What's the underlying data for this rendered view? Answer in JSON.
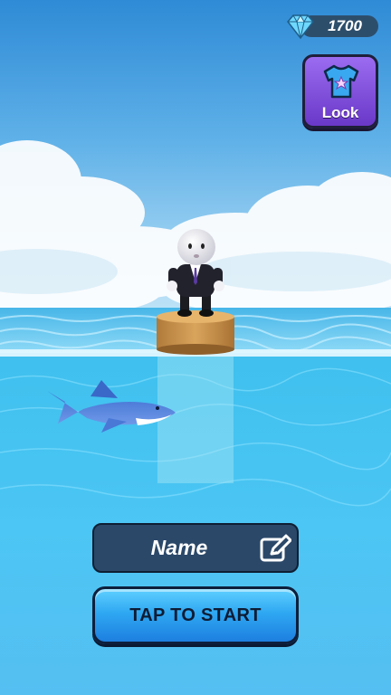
{
  "hud": {
    "gems": {
      "icon": "diamond-icon",
      "count": "1700"
    },
    "look_button": {
      "icon": "tshirt-star-icon",
      "label": "Look"
    }
  },
  "menu": {
    "name_field": {
      "label": "Name",
      "icon": "edit-pencil-icon"
    },
    "start_button": {
      "label": "TAP TO START"
    }
  },
  "colors": {
    "sky_top": "#2f8fd8",
    "sea": "#4cc6f4",
    "look_purple": "#7b47d6",
    "start_blue": "#2fa8f2",
    "name_panel": "#2b4869"
  }
}
